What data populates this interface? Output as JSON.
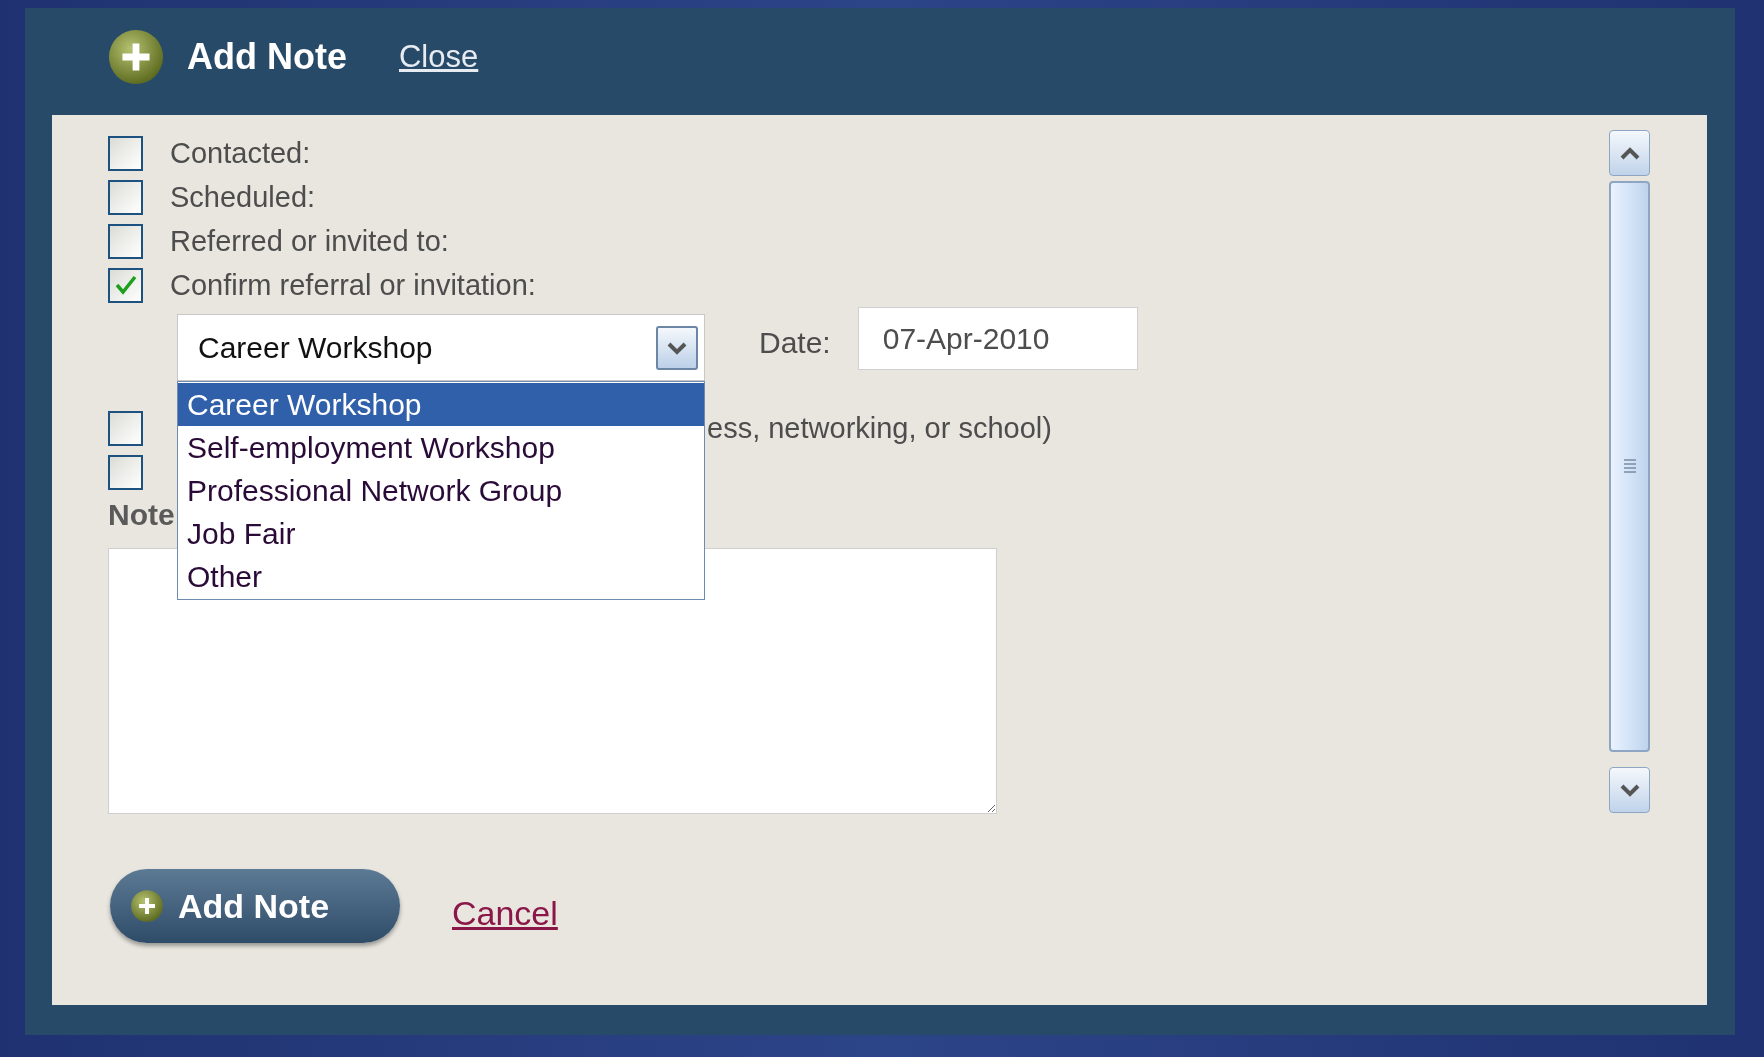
{
  "dialog": {
    "title": "Add Note",
    "close_link": "Close"
  },
  "checkboxes": [
    {
      "label": "Contacted:",
      "checked": false
    },
    {
      "label": "Scheduled:",
      "checked": false
    },
    {
      "label": "Referred or invited to:",
      "checked": false
    },
    {
      "label": "Confirm referral or invitation:",
      "checked": true
    }
  ],
  "referral": {
    "select_value": "Career Workshop",
    "expanded": true,
    "options": [
      {
        "label": "Career Workshop",
        "selected": true
      },
      {
        "label": "Self-employment Workshop",
        "selected": false
      },
      {
        "label": "Professional Network Group",
        "selected": false
      },
      {
        "label": "Job Fair",
        "selected": false
      },
      {
        "label": "Other",
        "selected": false
      }
    ],
    "date_label": "Date:",
    "date_value": "07-Apr-2010"
  },
  "more_checkboxes": [
    {
      "label": "ess, networking, or school)",
      "checked": false
    },
    {
      "checked": false
    }
  ],
  "notes": {
    "label": "Note"
  },
  "buttons": {
    "submit": "Add Note",
    "cancel": "Cancel"
  }
}
